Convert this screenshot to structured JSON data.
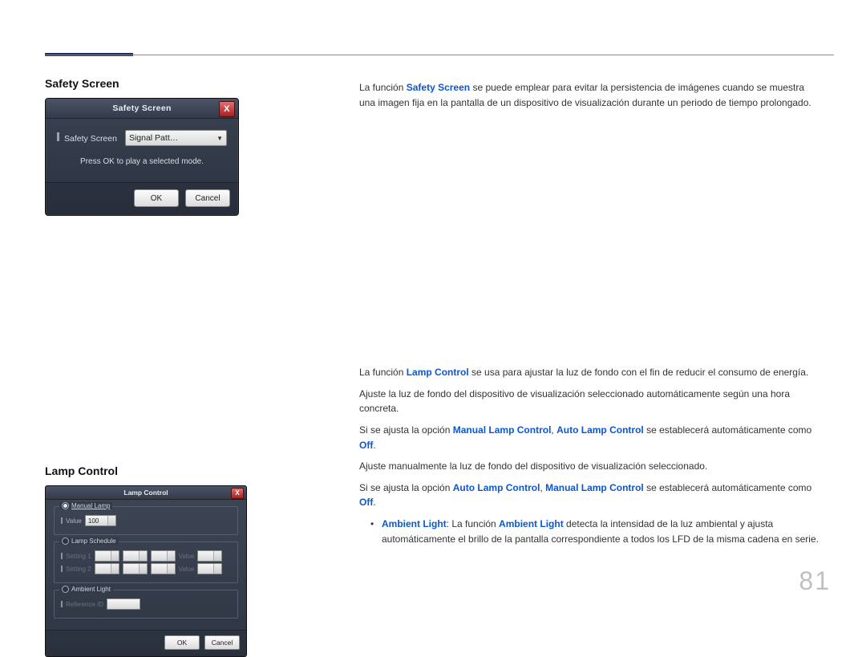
{
  "page_number": "81",
  "sections": {
    "safety": {
      "heading": "Safety Screen",
      "dialog": {
        "title": "Safety Screen",
        "field_label": "Safety Screen",
        "dropdown_value": "Signal Patt…",
        "hint": "Press OK to play a selected mode.",
        "ok": "OK",
        "cancel": "Cancel"
      },
      "body": {
        "p1_pre": "La función ",
        "p1_kw": "Safety Screen",
        "p1_post": " se puede emplear para evitar la persistencia de imágenes cuando se muestra una imagen fija en la pantalla de un dispositivo de visualización durante un periodo de tiempo prolongado."
      }
    },
    "lamp": {
      "heading": "Lamp Control",
      "dialog": {
        "title": "Lamp Control",
        "grp_manual": "Manual Lamp",
        "value_label": "Value",
        "value": "100",
        "grp_schedule": "Lamp Schedule",
        "setting1": "Setting 1",
        "setting2": "Setting 2",
        "sched_value_label": "Value",
        "grp_ambient": "Ambient Light",
        "ref_label": "Reference ID",
        "ok": "OK",
        "cancel": "Cancel"
      },
      "body": {
        "p1_pre": "La función ",
        "p1_kw": "Lamp Control",
        "p1_post": " se usa para ajustar la luz de fondo con el fin de reducir el consumo de energía.",
        "p2": "Ajuste la luz de fondo del dispositivo de visualización seleccionado automáticamente según una hora concreta.",
        "p3_a": "Si se ajusta la opción ",
        "p3_kw1": "Manual Lamp Control",
        "p3_b": ", ",
        "p3_kw2": "Auto Lamp Control",
        "p3_c": " se establecerá automáticamente como ",
        "p3_kw3": "Off",
        "p3_d": ".",
        "p4": "Ajuste manualmente la luz de fondo del dispositivo de visualización seleccionado.",
        "p5_a": "Si se ajusta la opción ",
        "p5_kw1": "Auto Lamp Control",
        "p5_b": ", ",
        "p5_kw2": "Manual Lamp Control",
        "p5_c": " se establecerá automáticamente como ",
        "p5_kw3": "Off",
        "p5_d": ".",
        "bullet_kw1": "Ambient Light",
        "bullet_a": ": La función ",
        "bullet_kw2": "Ambient Light",
        "bullet_b": " detecta la intensidad de la luz ambiental y ajusta automáticamente el brillo de la pantalla correspondiente a todos los LFD de la misma cadena en serie."
      }
    }
  }
}
